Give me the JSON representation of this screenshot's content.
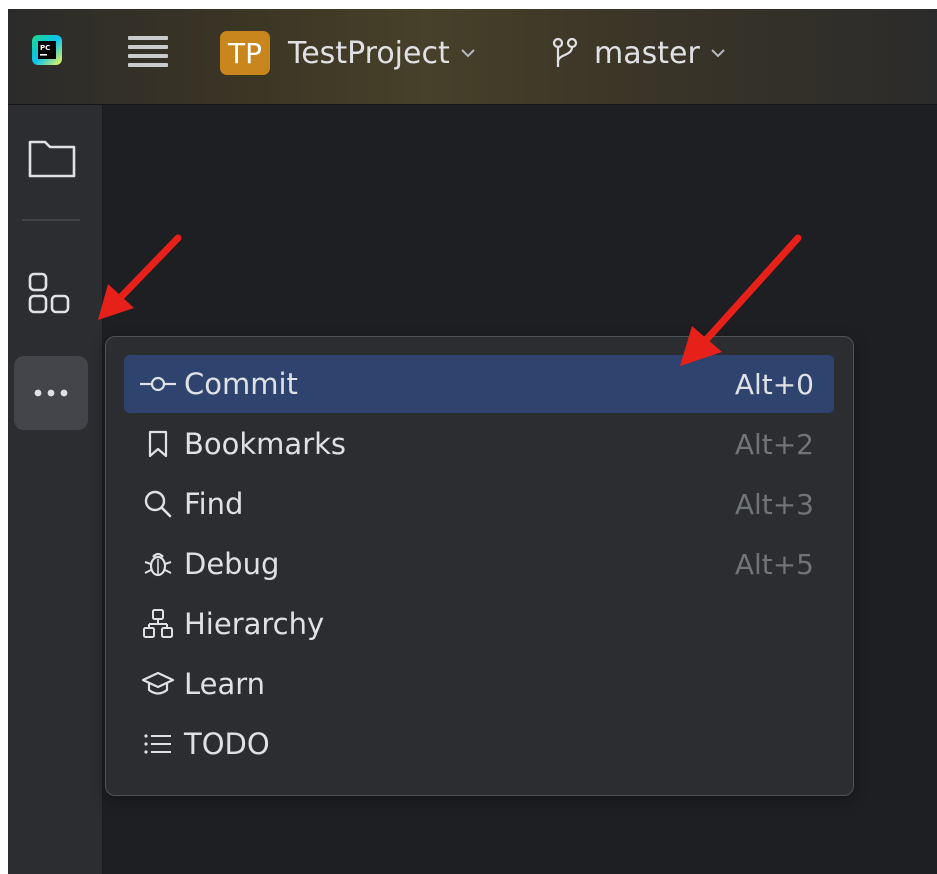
{
  "window": {
    "project": {
      "badge": "TP",
      "name": "TestProject",
      "badge_color": "#c8861c"
    },
    "branch": {
      "name": "master"
    }
  },
  "sidebar": {
    "items": [
      {
        "icon": "folder-icon"
      },
      {
        "icon": "structure-icon"
      },
      {
        "icon": "more-icon"
      }
    ]
  },
  "popup_menu": {
    "items": [
      {
        "label": "Commit",
        "shortcut": "Alt+0",
        "icon": "commit-icon",
        "selected": true
      },
      {
        "label": "Bookmarks",
        "shortcut": "Alt+2",
        "icon": "bookmark-icon"
      },
      {
        "label": "Find",
        "shortcut": "Alt+3",
        "icon": "search-icon"
      },
      {
        "label": "Debug",
        "shortcut": "Alt+5",
        "icon": "bug-icon"
      },
      {
        "label": "Hierarchy",
        "shortcut": "",
        "icon": "hierarchy-icon"
      },
      {
        "label": "Learn",
        "shortcut": "",
        "icon": "graduation-cap-icon"
      },
      {
        "label": "TODO",
        "shortcut": "",
        "icon": "list-icon"
      }
    ]
  },
  "colors": {
    "selection": "#2e436e",
    "annotation_arrow": "#e8201a"
  }
}
